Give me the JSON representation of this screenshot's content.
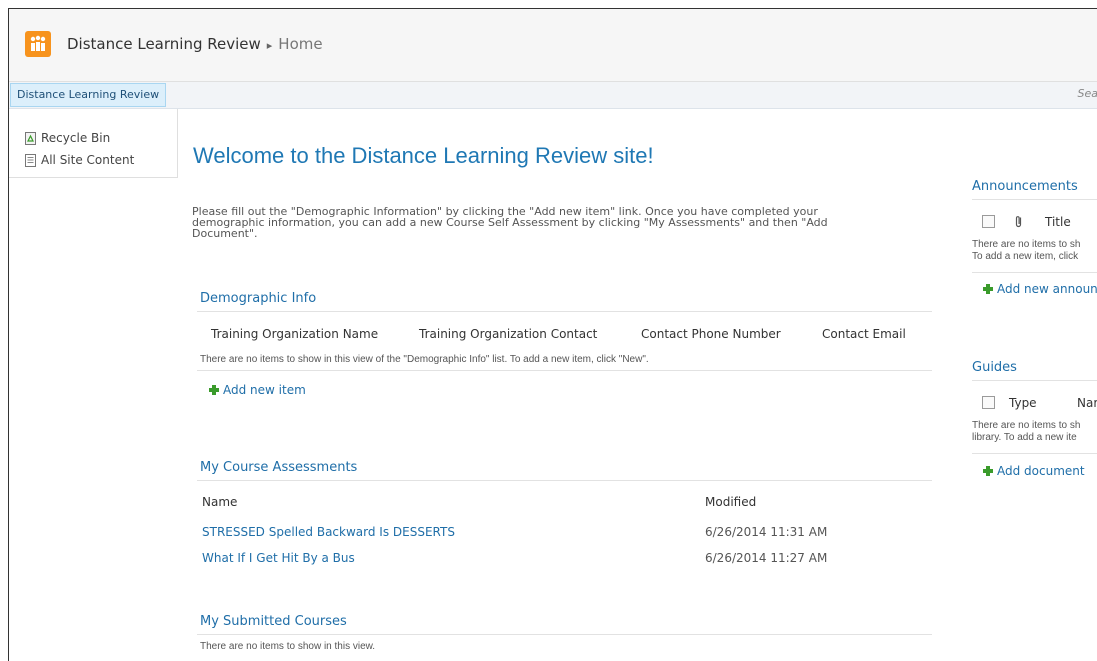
{
  "header": {
    "site_title": "Distance Learning Review",
    "separator": "▸",
    "page": "Home"
  },
  "nav": {
    "tab_label": "Distance Learning Review",
    "search_hint": "Sea"
  },
  "sidebar": {
    "items": [
      {
        "label": "Recycle Bin",
        "icon": "recycle-bin-icon"
      },
      {
        "label": "All Site Content",
        "icon": "site-content-icon"
      }
    ]
  },
  "main": {
    "welcome": "Welcome to the Distance Learning Review site!",
    "intro_line1": "Please fill out the \"Demographic Information\" by clicking the \"Add new item\" link.  Once you have completed your",
    "intro_line2": "demographic information, you can add a new Course Self Assessment by clicking \"My Assessments\" and then \"Add",
    "intro_line3": "Document\".",
    "demographic": {
      "title": "Demographic Info",
      "columns": [
        "Training Organization Name",
        "Training Organization Contact",
        "Contact Phone Number",
        "Contact Email"
      ],
      "empty_text": "There are no items to show in this view of the \"Demographic Info\" list. To add a new item, click \"New\".",
      "add_label": "Add new item"
    },
    "assessments": {
      "title": "My Course Assessments",
      "col_name": "Name",
      "col_modified": "Modified",
      "rows": [
        {
          "name": "STRESSED Spelled Backward Is DESSERTS",
          "modified": "6/26/2014 11:31 AM"
        },
        {
          "name": "What If I Get Hit By a Bus",
          "modified": "6/26/2014 11:27 AM"
        }
      ]
    },
    "submitted": {
      "title": "My Submitted Courses",
      "empty_text": "There are no items to show in this view."
    }
  },
  "right": {
    "announcements": {
      "title": "Announcements",
      "col_title": "Title",
      "empty_line1": "There are no items to sh",
      "empty_line2": "To add a new item, click",
      "add_label": "Add new announ"
    },
    "guides": {
      "title": "Guides",
      "col_type": "Type",
      "col_name": "Nar",
      "empty_line1": "There are no items to sh",
      "empty_line2": "library. To add a new ite",
      "add_label": "Add document"
    }
  },
  "colors": {
    "accent": "#1f6ea8",
    "logo": "#f7931d",
    "add_plus": "#3a9b2b"
  }
}
